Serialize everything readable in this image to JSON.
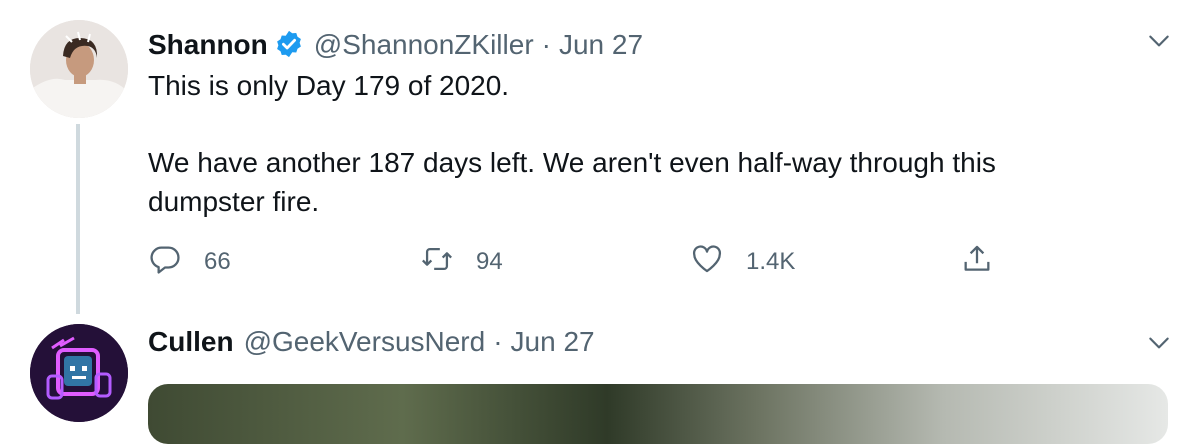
{
  "tweets": [
    {
      "name": "Shannon",
      "verified": true,
      "handle": "@ShannonZKiller",
      "separator": "·",
      "date": "Jun 27",
      "text_lines": [
        "This is only Day 179 of 2020.",
        "We have another 187 days left. We aren't even half-way through this",
        "dumpster fire."
      ],
      "reply_count": "66",
      "retweet_count": "94",
      "like_count": "1.4K"
    },
    {
      "name": "Cullen",
      "verified": false,
      "handle": "@GeekVersusNerd",
      "separator": "·",
      "date": "Jun 27"
    }
  ],
  "icons": {
    "verified": "verified-badge-icon",
    "caret": "chevron-down-icon",
    "reply": "reply-icon",
    "retweet": "retweet-icon",
    "like": "heart-icon",
    "share": "share-icon"
  },
  "colors": {
    "verified_blue": "#1d9bf0",
    "text_secondary": "#536471",
    "thread_line": "#cfd9de"
  }
}
